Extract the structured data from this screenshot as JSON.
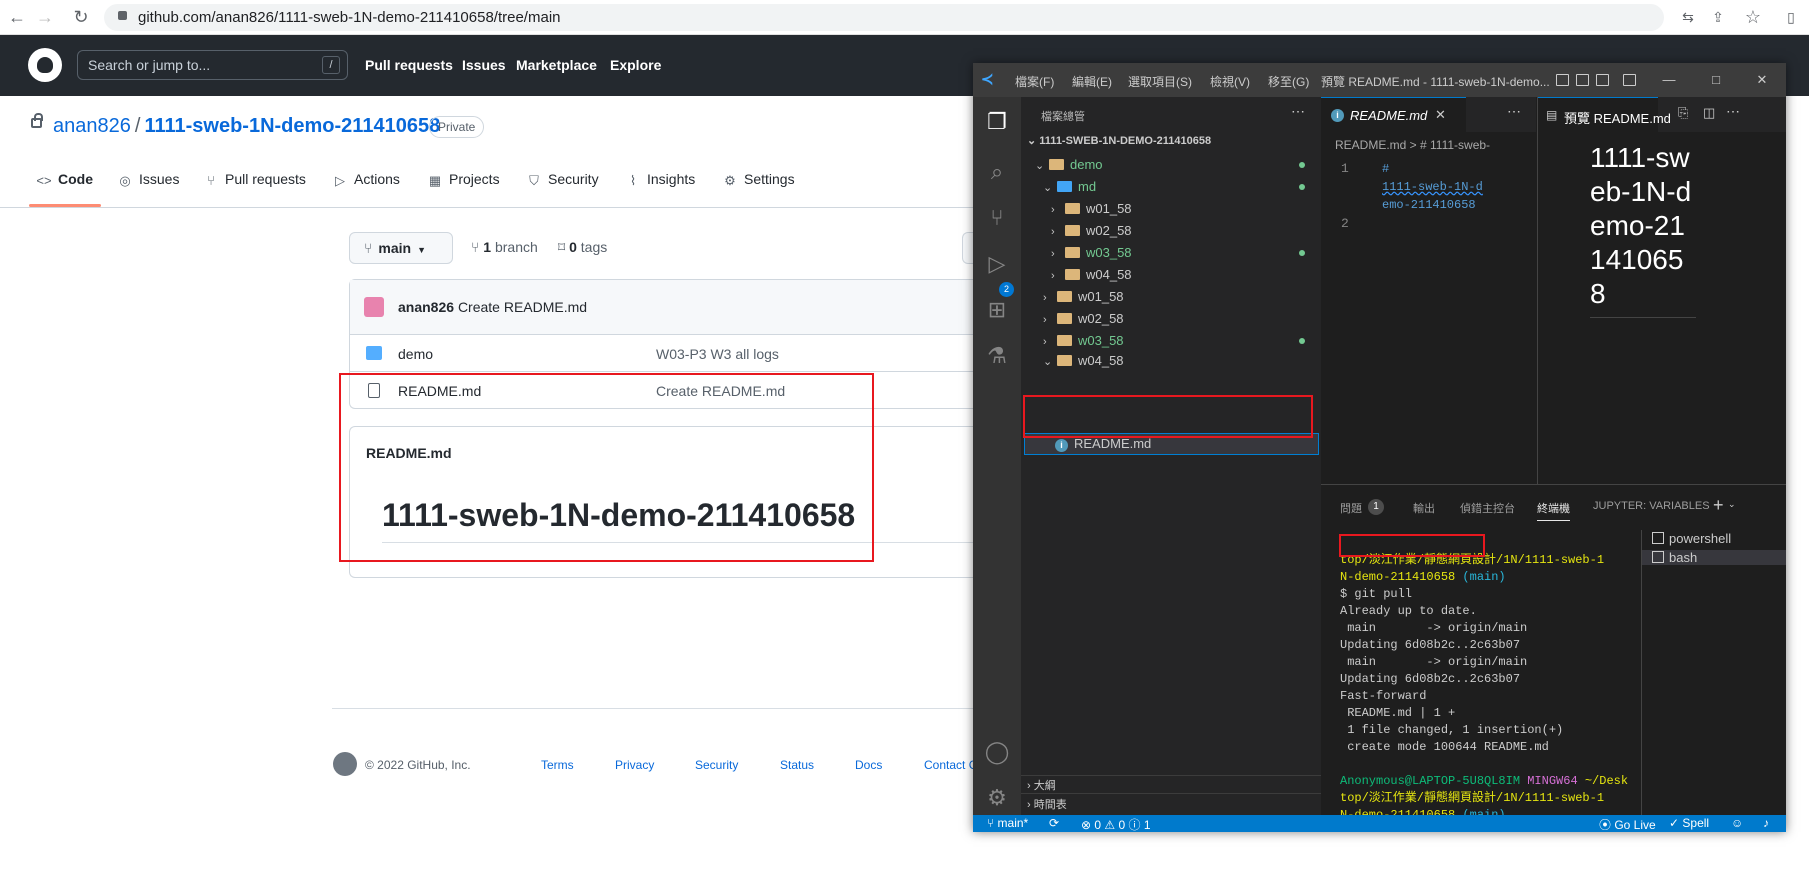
{
  "browser": {
    "url": "github.com/anan826/1111-sweb-1N-demo-211410658/tree/main"
  },
  "gh_header": {
    "search_placeholder": "Search or jump to...",
    "slash_key": "/",
    "nav": [
      "Pull requests",
      "Issues",
      "Marketplace",
      "Explore"
    ]
  },
  "repo": {
    "owner": "anan826",
    "separator": "/",
    "name": "1111-sweb-1N-demo-211410658",
    "visibility": "Private",
    "tabs": [
      "Code",
      "Issues",
      "Pull requests",
      "Actions",
      "Projects",
      "Security",
      "Insights",
      "Settings"
    ],
    "branch": "main",
    "branch_count": "1",
    "branch_label": "branch",
    "tag_count": "0",
    "tag_label": "tags"
  },
  "commit": {
    "author": "anan826",
    "message": "Create README.md"
  },
  "files": [
    {
      "name": "demo",
      "message": "W03-P3 W3 all logs",
      "icon": "folder-icon"
    },
    {
      "name": "README.md",
      "message": "Create README.md",
      "icon": "file-icon"
    }
  ],
  "readme": {
    "label": "README.md",
    "heading": "1111-sweb-1N-demo-211410658"
  },
  "footer": {
    "copyright": "© 2022 GitHub, Inc.",
    "links": [
      "Terms",
      "Privacy",
      "Security",
      "Status",
      "Docs",
      "Contact G"
    ]
  },
  "vscode": {
    "menus": [
      "檔案(F)",
      "編輯(E)",
      "選取項目(S)",
      "檢視(V)",
      "移至(G)"
    ],
    "window_title": "預覽 README.md - 1111-sweb-1N-demo...",
    "explorer_title": "檔案總管",
    "root": "1111-SWEB-1N-DEMO-211410658",
    "tree": [
      {
        "label": "demo",
        "indent": 1,
        "open": true,
        "mod": true
      },
      {
        "label": "md",
        "indent": 2,
        "open": true,
        "mod": true
      },
      {
        "label": "w01_58",
        "indent": 3,
        "open": false,
        "mod": false
      },
      {
        "label": "w02_58",
        "indent": 3,
        "open": false,
        "mod": false
      },
      {
        "label": "w03_58",
        "indent": 3,
        "open": false,
        "mod": true
      },
      {
        "label": "w04_58",
        "indent": 3,
        "open": false,
        "mod": false
      },
      {
        "label": "w01_58",
        "indent": 2,
        "open": false,
        "mod": false
      },
      {
        "label": "w02_58",
        "indent": 2,
        "open": false,
        "mod": false
      },
      {
        "label": "w03_58",
        "indent": 2,
        "open": false,
        "mod": true
      },
      {
        "label": "w04_58",
        "indent": 2,
        "open": false,
        "mod": false
      }
    ],
    "selected_file": "README.md",
    "source_control_badge": "2",
    "outline_label": "大綱",
    "timeline_label": "時間表",
    "editor_tab": "README.md",
    "breadcrumb": "README.md > # 1111-sweb-",
    "code_lines": [
      {
        "n": "1",
        "text": "#"
      },
      {
        "n": "",
        "text": "1111-sweb-1N-d"
      },
      {
        "n": "",
        "text": "emo-211410658"
      },
      {
        "n": "2",
        "text": ""
      }
    ],
    "preview_tab": "預覽 README.md",
    "preview_heading": "1111-sweb-1N-demo-211410658",
    "panel_tabs": [
      "問題",
      "輸出",
      "偵錯主控台",
      "終端機",
      "JUPYTER: VARIABLES"
    ],
    "problems_count": "1",
    "terminal_lines": [
      {
        "text": "top/淡江作業/靜態網頁設計/1N/1111-sweb-1",
        "cls": "y"
      },
      {
        "text": "N-demo-211410658",
        "cls": "y",
        "suffix": " (main)"
      },
      {
        "text": "$ git pull",
        "cls": ""
      },
      {
        "text": "Already up to date.",
        "cls": ""
      },
      {
        "text": " main       -> origin/main",
        "cls": ""
      },
      {
        "text": "Updating 6d08b2c..2c63b07",
        "cls": ""
      },
      {
        "text": " main       -> origin/main",
        "cls": ""
      },
      {
        "text": "Updating 6d08b2c..2c63b07",
        "cls": ""
      },
      {
        "text": "Fast-forward",
        "cls": ""
      },
      {
        "text": " README.md | 1 +",
        "cls": ""
      },
      {
        "text": " 1 file changed, 1 insertion(+)",
        "cls": ""
      },
      {
        "text": " create mode 100644 README.md",
        "cls": ""
      },
      {
        "text": "",
        "cls": ""
      },
      {
        "text": "Anonymous@LAPTOP-5U8QL8IM",
        "cls": "gr",
        "mid": " MINGW64",
        "end": " ~/Desk"
      },
      {
        "text": "top/淡江作業/靜態網頁設計/1N/1111-sweb-1",
        "cls": "y"
      },
      {
        "text": "N-demo-211410658",
        "cls": "y",
        "suffix": " (main)"
      },
      {
        "text": "$ ",
        "cls": "",
        "cursor": true
      }
    ],
    "terminals": [
      "powershell",
      "bash"
    ],
    "status": {
      "branch": "main*",
      "errors": "0",
      "warnings": "0",
      "infos": "1",
      "golive": "Go Live",
      "spell": "Spell"
    }
  },
  "colors": {
    "github_header": "#24292f",
    "link": "#0969da",
    "vscode_status": "#007acc",
    "highlight_box": "#e8181f"
  }
}
